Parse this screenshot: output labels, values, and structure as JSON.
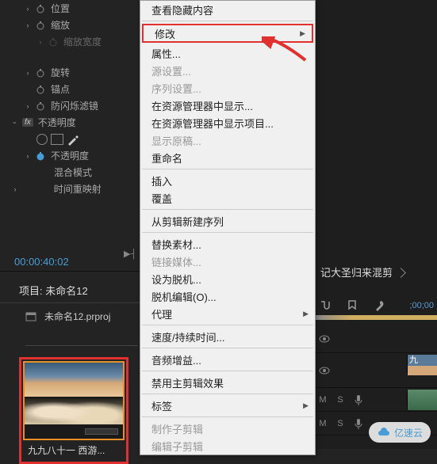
{
  "effects_panel": {
    "rows": [
      {
        "label": "位置",
        "indent": "nested"
      },
      {
        "label": "缩放",
        "indent": "nested",
        "twirl": true
      },
      {
        "label": "缩放宽度",
        "indent": "deep"
      },
      {
        "label": "旋转",
        "indent": "nested"
      },
      {
        "label": "锚点",
        "indent": "nested"
      },
      {
        "label": "防闪烁滤镜",
        "indent": "nested"
      }
    ],
    "opacity_section": "不透明度",
    "opacity_prop": "不透明度",
    "blend_mode": "混合模式",
    "time_remap": "时间重映射"
  },
  "timecode": "00:00:40:02",
  "project": {
    "title": "项目: 未命名12",
    "filename": "未命名12.prproj",
    "thumb_label": "九九八十一 西游..."
  },
  "context_menu": {
    "items": [
      {
        "label": "查看隐藏内容",
        "enabled": true
      },
      {
        "sep": true
      },
      {
        "label": "修改",
        "enabled": true,
        "submenu": true,
        "highlighted": true
      },
      {
        "label": "属性...",
        "enabled": true
      },
      {
        "label": "源设置...",
        "enabled": false
      },
      {
        "label": "序列设置...",
        "enabled": false
      },
      {
        "label": "在资源管理器中显示...",
        "enabled": true
      },
      {
        "label": "在资源管理器中显示项目...",
        "enabled": true
      },
      {
        "label": "显示原稿...",
        "enabled": false
      },
      {
        "label": "重命名",
        "enabled": true
      },
      {
        "sep": true
      },
      {
        "label": "插入",
        "enabled": true
      },
      {
        "label": "覆盖",
        "enabled": true
      },
      {
        "sep": true
      },
      {
        "label": "从剪辑新建序列",
        "enabled": true
      },
      {
        "sep": true
      },
      {
        "label": "替换素材...",
        "enabled": true
      },
      {
        "label": "链接媒体...",
        "enabled": false
      },
      {
        "label": "设为脱机...",
        "enabled": true
      },
      {
        "label": "脱机编辑(O)...",
        "enabled": true
      },
      {
        "label": "代理",
        "enabled": true,
        "submenu": true
      },
      {
        "sep": true
      },
      {
        "label": "速度/持续时间...",
        "enabled": true
      },
      {
        "sep": true
      },
      {
        "label": "音频增益...",
        "enabled": true
      },
      {
        "sep": true
      },
      {
        "label": "禁用主剪辑效果",
        "enabled": true
      },
      {
        "sep": true
      },
      {
        "label": "标签",
        "enabled": true,
        "submenu": true
      },
      {
        "sep": true
      },
      {
        "label": "制作子剪辑",
        "enabled": false
      },
      {
        "label": "编辑子剪辑",
        "enabled": false
      }
    ]
  },
  "right_panel": {
    "tab_title": "记大圣归来混剪",
    "ruler_time": ";00;00"
  },
  "tracks": {
    "letters": [
      "M",
      "S",
      "M",
      "S"
    ],
    "clip_name": "九"
  },
  "watermark": "亿速云"
}
